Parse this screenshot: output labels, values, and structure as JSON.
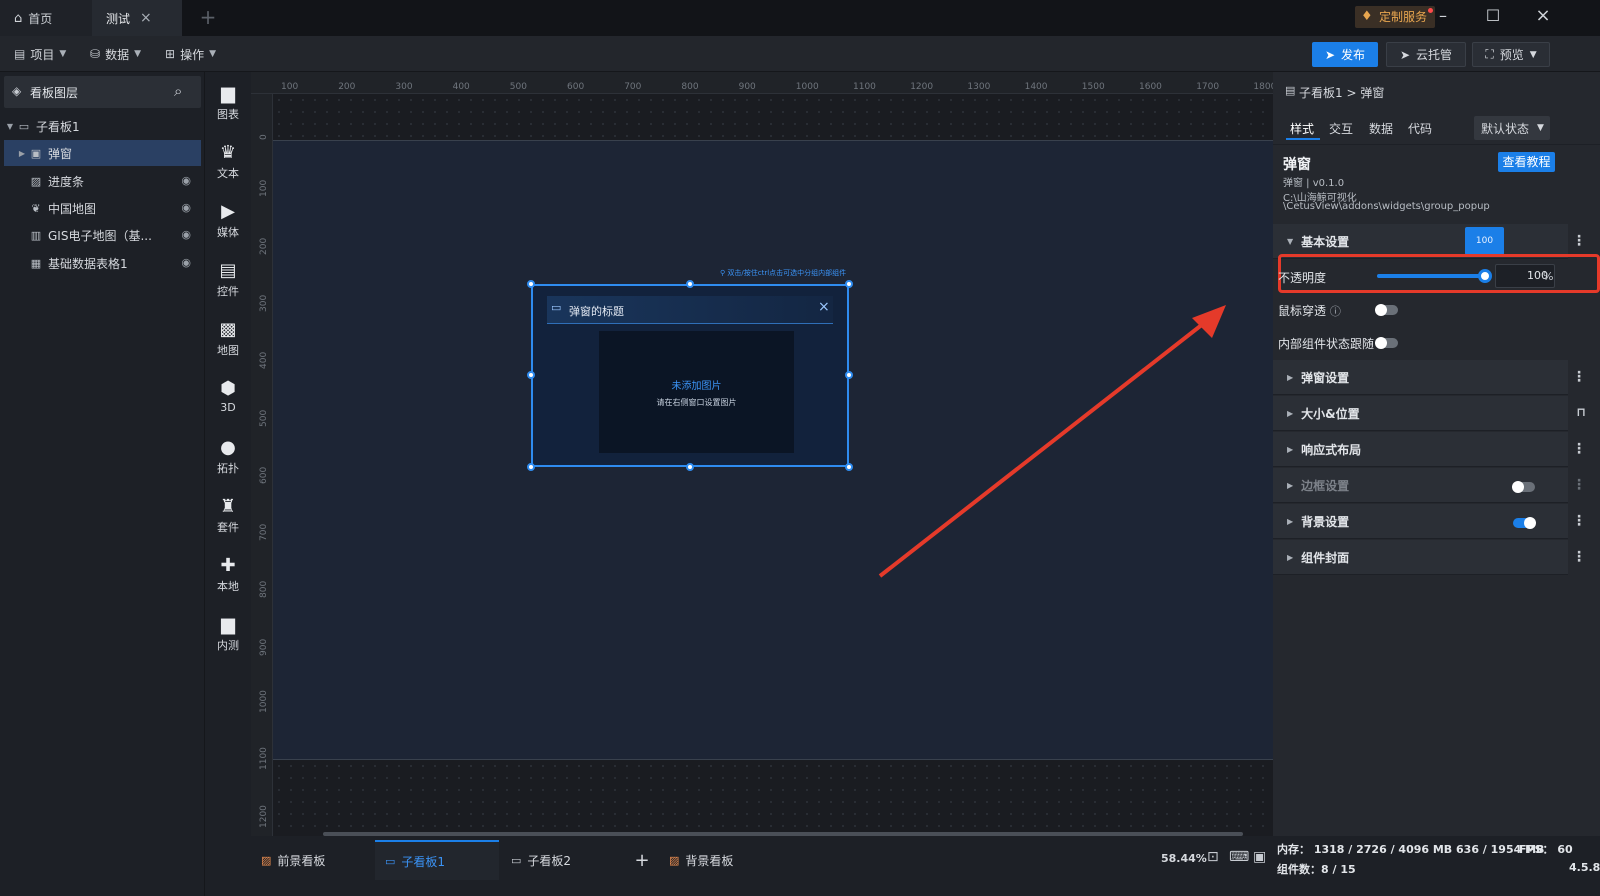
{
  "tabs": {
    "home": "首页",
    "active": "测试"
  },
  "window": {
    "service_label": "定制服务"
  },
  "toolbar": {
    "menus": [
      "项目",
      "数据",
      "操作"
    ],
    "publish": "发布",
    "cloud": "云托管",
    "preview": "预览"
  },
  "layers": {
    "title": "看板图层",
    "root": "子看板1",
    "items": [
      "弹窗",
      "进度条",
      "中国地图",
      "GIS电子地图（基...",
      "基础数据表格1"
    ]
  },
  "categories": [
    "图表",
    "文本",
    "媒体",
    "控件",
    "地图",
    "3D",
    "拓扑",
    "套件",
    "本地",
    "内测"
  ],
  "ruler": {
    "h": [
      "100",
      "200",
      "300",
      "400",
      "500",
      "600",
      "700",
      "800",
      "900",
      "1000",
      "1100",
      "1200",
      "1300",
      "1400",
      "1500",
      "1600",
      "1700",
      "1800"
    ],
    "v": [
      "0",
      "100",
      "200",
      "300",
      "400",
      "500",
      "600",
      "700",
      "800",
      "900",
      "1000",
      "1100",
      "1200"
    ]
  },
  "canvas": {
    "hint": "双击/按住ctrl点击可选中分组内部组件",
    "popup_title": "弹窗的标题",
    "no_image": "未添加图片",
    "no_image_hint": "请在右侧窗口设置图片"
  },
  "inspector": {
    "breadcrumb": "子看板1 > 弹窗",
    "tabs": [
      "样式",
      "交互",
      "数据",
      "代码"
    ],
    "state": "默认状态",
    "component_name": "弹窗",
    "version": "弹窗 | v0.1.0",
    "path1": "C:\\山海鲸可视化",
    "path2": "\\CetusView\\addons\\widgets\\group_popup",
    "tutorial": "查看教程",
    "basic": "基本设置",
    "tooltip_value": "100",
    "opacity_label": "不透明度",
    "opacity_value": "100",
    "opacity_unit": "%",
    "opacity_level": 100,
    "mouse_through": "鼠标穿透",
    "inner_follow": "内部组件状态跟随",
    "sections": [
      "弹窗设置",
      "大小&位置",
      "响应式布局",
      "边框设置",
      "背景设置",
      "组件封面"
    ]
  },
  "bottom": {
    "tabs": [
      "前景看板",
      "子看板1",
      "子看板2",
      "背景看板"
    ],
    "zoom": "58.44%"
  },
  "status": {
    "memory": "内存：  1318 / 2726 / 4096 MB   636 / 1954 MB",
    "fps": "FPS：  60",
    "count": "组件数：8 / 15",
    "version": "4.5.8"
  },
  "colors": {
    "accent": "#1b7fe8",
    "highlight": "#e53a2a",
    "selection": "#2f8cf0"
  }
}
